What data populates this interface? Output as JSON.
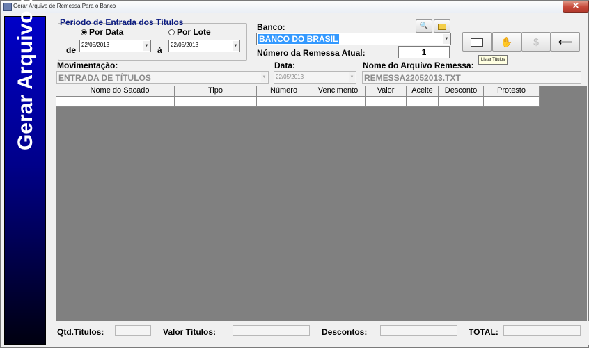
{
  "window": {
    "title": "Gerar Arquivo de Remessa Para o Banco",
    "close_label": "✕"
  },
  "banner": {
    "text": "Gerar Arquivo de Remessa"
  },
  "periodo": {
    "title": "Período de Entrada dos Títulos",
    "option_data": "Por Data",
    "option_lote": "Por Lote",
    "selected": "Por Data",
    "de_label": "de",
    "a_label": "à",
    "date_from": "22/05/2013",
    "date_to": "22/05/2013"
  },
  "banco": {
    "label": "Banco:",
    "value": "BANCO DO BRASIL",
    "numero_label": "Número da Remessa Atual:",
    "numero_value": "1"
  },
  "toolbar": {
    "search_icon": "search-icon",
    "folder_icon": "folder-icon",
    "tooltip": "Listar Títulos"
  },
  "movimentacao": {
    "label": "Movimentação:",
    "value": "ENTRADA DE TÍTULOS"
  },
  "data": {
    "label": "Data:",
    "value": "22/05/2013"
  },
  "arquivo": {
    "label": "Nome do Arquivo Remessa:",
    "value": "REMESSA22052013.TXT"
  },
  "table": {
    "columns": [
      "",
      "Nome do Sacado",
      "Tipo",
      "Número",
      "Vencimento",
      "Valor",
      "Aceite",
      "Desconto",
      "Protesto"
    ]
  },
  "footer": {
    "qtd_label": "Qtd.Títulos:",
    "valor_label": "Valor Títulos:",
    "descontos_label": "Descontos:",
    "total_label": "TOTAL:"
  },
  "colors": {
    "selection": "#3399ff",
    "banner_top": "#0000c8",
    "grid_bg": "#808080"
  }
}
